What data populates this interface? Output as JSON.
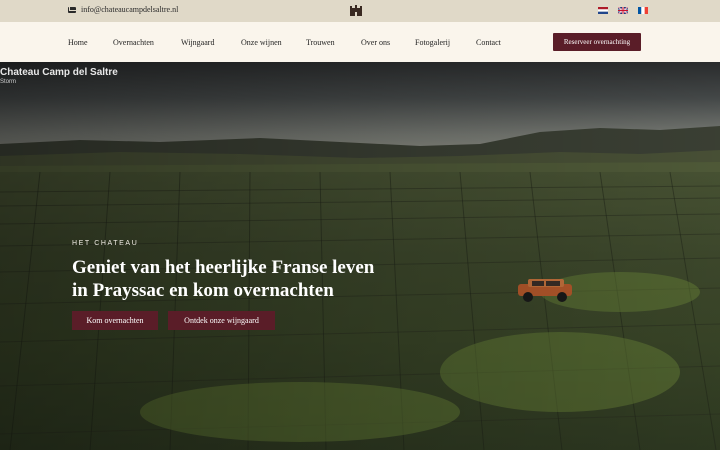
{
  "topbar": {
    "email": "info@chateaucampdelsaltre.nl",
    "email_icon": "mail-icon",
    "logo_icon": "castle-icon",
    "languages": [
      "nl-flag-icon",
      "uk-flag-icon",
      "fr-flag-icon"
    ]
  },
  "nav": {
    "items": [
      "Home",
      "Overnachten",
      "Wijngaard",
      "Onze wijnen",
      "Trouwen",
      "Over ons",
      "Fotogalerij",
      "Contact"
    ],
    "cta": "Reserveer overnachting"
  },
  "hero": {
    "brand_title": "Chateau Camp del Saltre",
    "brand_subtitle": "Storm",
    "eyebrow": "HET CHATEAU",
    "headline_line1": "Geniet van het heerlijke Franse leven",
    "headline_line2": "in Prayssac en kom overnachten",
    "button_primary": "Kom overnachten",
    "button_secondary": "Ontdek onze wijngaard"
  },
  "colors": {
    "accent": "#5a1d28",
    "topbar_bg": "#e0d9c8",
    "nav_bg": "#faf5ec"
  }
}
